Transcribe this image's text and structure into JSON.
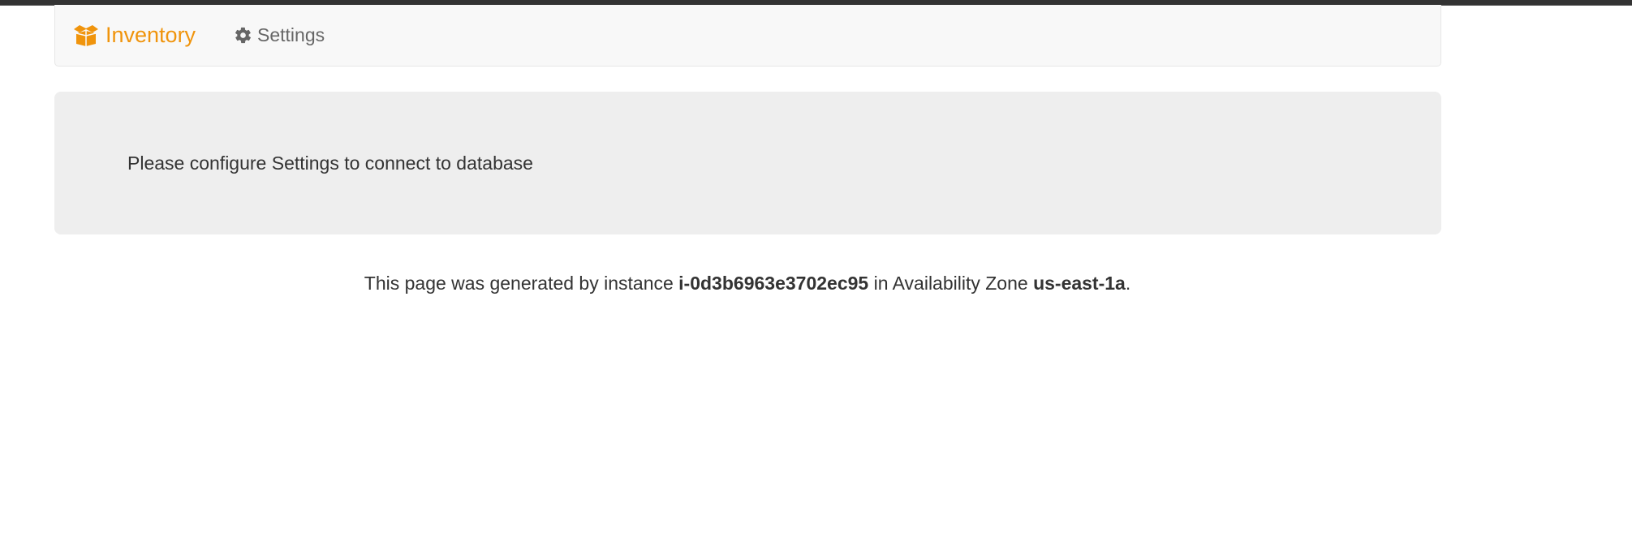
{
  "navbar": {
    "brand_label": "Inventory",
    "brand_icon": "box-open-icon",
    "settings_label": "Settings",
    "settings_icon": "gear-icon",
    "brand_color": "#f0940c"
  },
  "jumbotron": {
    "message": "Please configure Settings to connect to database"
  },
  "footer": {
    "prefix": "This page was generated by instance ",
    "instance_id": "i-0d3b6963e3702ec95",
    "middle": " in Availability Zone ",
    "availability_zone": "us-east-1a",
    "suffix": "."
  }
}
